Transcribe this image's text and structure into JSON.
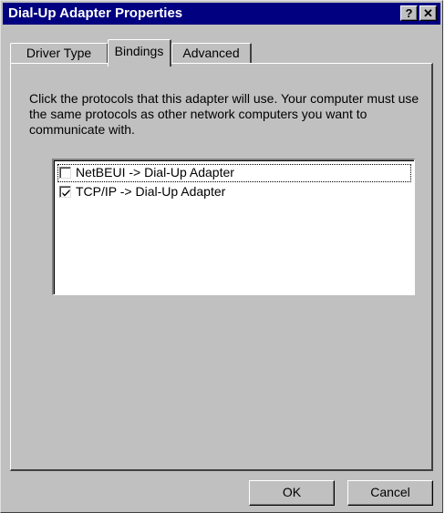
{
  "window": {
    "title": "Dial-Up Adapter Properties",
    "help_glyph": "?",
    "close_glyph": "✕"
  },
  "tabs": [
    {
      "label": "Driver Type",
      "selected": false
    },
    {
      "label": "Bindings",
      "selected": true
    },
    {
      "label": "Advanced",
      "selected": false
    }
  ],
  "bindings": {
    "description": "Click the protocols that this adapter will use. Your computer must use the same protocols as other network computers you want to communicate with.",
    "items": [
      {
        "label": "NetBEUI -> Dial-Up Adapter",
        "checked": false,
        "focused": true
      },
      {
        "label": "TCP/IP -> Dial-Up Adapter",
        "checked": true,
        "focused": false
      }
    ]
  },
  "buttons": {
    "ok": "OK",
    "cancel": "Cancel"
  },
  "colors": {
    "face": "#c0c0c0",
    "titlebar": "#000080",
    "list_bg": "#ffffff"
  }
}
